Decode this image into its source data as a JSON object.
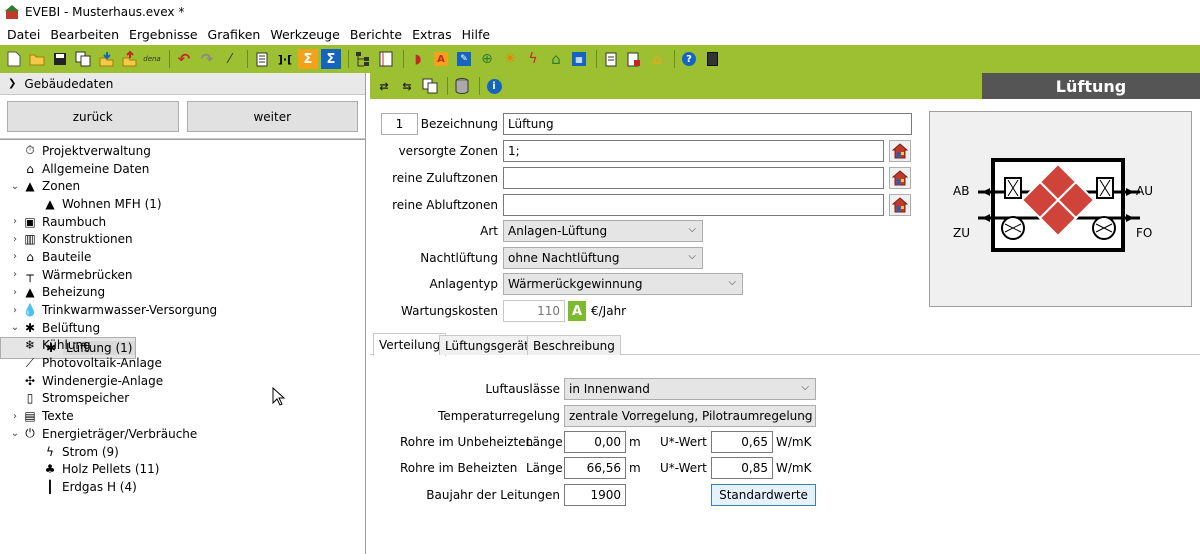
{
  "window": {
    "title": "EVEBI - Musterhaus.evex *"
  },
  "menu": [
    "Datei",
    "Bearbeiten",
    "Ergebnisse",
    "Grafiken",
    "Werkzeuge",
    "Berichte",
    "Extras",
    "Hilfe"
  ],
  "toolbar_icons": [
    "new-icon",
    "open-icon",
    "save-icon",
    "copy-icon",
    "import-icon",
    "export-icon",
    "dena-icon",
    "undo-icon",
    "redo-icon",
    "wizard-icon",
    "report-icon",
    "compare-icon",
    "sum-icon",
    "sum-blue-icon",
    "hierarchy-icon",
    "list-icon",
    "roof-icon",
    "a-icon",
    "edit-icon",
    "globe-icon",
    "sun-icon",
    "bolt-icon",
    "house-icon",
    "calc-icon",
    "doc-icon",
    "doc-red-icon",
    "house-outline-icon",
    "help-icon",
    "calculator-icon"
  ],
  "toolbar_labels": {
    "dena": "dena"
  },
  "left": {
    "header": "Gebäudedaten",
    "back_label": "zurück",
    "next_label": "weiter",
    "tree": [
      {
        "label": "Projektverwaltung",
        "level": 0,
        "expander": "",
        "icon": "clock-icon",
        "glyph": "⏱"
      },
      {
        "label": "Allgemeine Daten",
        "level": 0,
        "expander": "",
        "icon": "house-icon",
        "glyph": "⌂"
      },
      {
        "label": "Zonen",
        "level": 0,
        "expander": "⌄",
        "icon": "zone-icon",
        "glyph": "▲"
      },
      {
        "label": "Wohnen MFH (1)",
        "level": 1,
        "expander": "",
        "icon": "zone-icon",
        "glyph": "▲"
      },
      {
        "label": "Raumbuch",
        "level": 0,
        "expander": "›",
        "icon": "room-icon",
        "glyph": "▣"
      },
      {
        "label": "Konstruktionen",
        "level": 0,
        "expander": "›",
        "icon": "construction-icon",
        "glyph": "▥"
      },
      {
        "label": "Bauteile",
        "level": 0,
        "expander": "›",
        "icon": "component-icon",
        "glyph": "⌂"
      },
      {
        "label": "Wärmebrücken",
        "level": 0,
        "expander": "›",
        "icon": "thermal-bridge-icon",
        "glyph": "┬"
      },
      {
        "label": "Beheizung",
        "level": 0,
        "expander": "›",
        "icon": "heating-icon",
        "glyph": "▲"
      },
      {
        "label": "Trinkwarmwasser-Versorgung",
        "level": 0,
        "expander": "›",
        "icon": "water-drop-icon",
        "glyph": "💧"
      },
      {
        "label": "Belüftung",
        "level": 0,
        "expander": "⌄",
        "icon": "fan-icon",
        "glyph": "✱"
      },
      {
        "label": "Lüftung (1)",
        "level": 1,
        "expander": "",
        "icon": "fan-icon",
        "glyph": "✱",
        "selected": true
      },
      {
        "label": "Kühlung",
        "level": 0,
        "expander": "",
        "icon": "snowflake-icon",
        "glyph": "❄"
      },
      {
        "label": "Photovoltaik-Anlage",
        "level": 0,
        "expander": "",
        "icon": "pv-icon",
        "glyph": "⟋"
      },
      {
        "label": "Windenergie-Anlage",
        "level": 0,
        "expander": "",
        "icon": "wind-icon",
        "glyph": "✣"
      },
      {
        "label": "Stromspeicher",
        "level": 0,
        "expander": "",
        "icon": "battery-icon",
        "glyph": "▯"
      },
      {
        "label": "Texte",
        "level": 0,
        "expander": "›",
        "icon": "text-icon",
        "glyph": "▤"
      },
      {
        "label": "Energieträger/Verbräuche",
        "level": 0,
        "expander": "⌄",
        "icon": "plug-icon",
        "glyph": "⏻"
      },
      {
        "label": "Strom (9)",
        "level": 1,
        "expander": "",
        "icon": "bolt-icon",
        "glyph": "ϟ"
      },
      {
        "label": "Holz Pellets (11)",
        "level": 1,
        "expander": "",
        "icon": "tree-icon",
        "glyph": "♣"
      },
      {
        "label": "Erdgas H (4)",
        "level": 1,
        "expander": "",
        "icon": "gas-icon",
        "glyph": "┃"
      }
    ]
  },
  "right": {
    "title": "Lüftung",
    "number": "1",
    "fields": {
      "bezeichnung_label": "Bezeichnung",
      "bezeichnung_value": "Lüftung",
      "versorgte_label": "versorgte Zonen",
      "versorgte_value": "1;",
      "zuluft_label": "reine Zuluftzonen",
      "zuluft_value": "",
      "abluft_label": "reine Abluftzonen",
      "abluft_value": "",
      "art_label": "Art",
      "art_value": "Anlagen-Lüftung",
      "nacht_label": "Nachtlüftung",
      "nacht_value": "ohne Nachtlüftung",
      "typ_label": "Anlagentyp",
      "typ_value": "Wärmerückgewinnung",
      "wartung_label": "Wartungskosten",
      "wartung_value": "110",
      "wartung_badge": "A",
      "wartung_unit": "€/Jahr"
    },
    "diagram": {
      "ab": "AB",
      "au": "AU",
      "zu": "ZU",
      "fo": "FO"
    },
    "tabs": [
      "Verteilung",
      "Lüftungsgerät",
      "Beschreibung"
    ],
    "verteilung": {
      "luftauslaesse_label": "Luftauslässe",
      "luftauslaesse_value": "in Innenwand",
      "temp_label": "Temperaturregelung",
      "temp_value": "zentrale Vorregelung, Pilotraumregelung",
      "unbeheizt_label": "Rohre im Unbeheizten",
      "beheizt_label": "Rohre im Beheizten",
      "laenge_label": "Länge",
      "uwert_label": "U*-Wert",
      "unbeheizt_laenge": "0,00",
      "unbeheizt_uwert": "0,65",
      "beheizt_laenge": "66,56",
      "beheizt_uwert": "0,85",
      "unit_m": "m",
      "unit_wmk": "W/mK",
      "baujahr_label": "Baujahr der Leitungen",
      "baujahr_value": "1900",
      "standard_label": "Standardwerte"
    }
  },
  "colors": {
    "accent": "#9cc031",
    "title_bg": "#555555",
    "house_red": "#c0392b"
  }
}
